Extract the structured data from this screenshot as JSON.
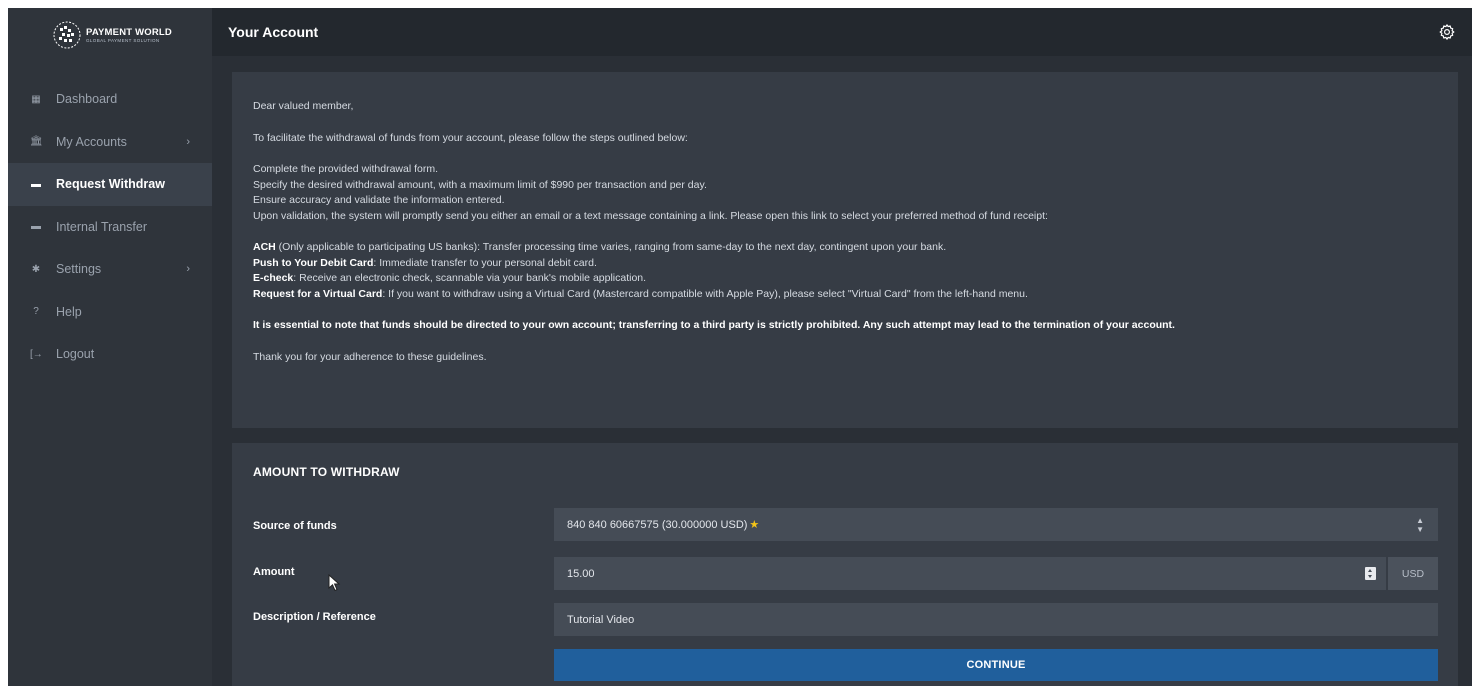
{
  "brand": {
    "name": "PAYMENT WORLD",
    "tagline": "GLOBAL PAYMENT SOLUTION"
  },
  "sidebar": {
    "items": [
      {
        "label": "Dashboard",
        "icon": "dashboard-icon",
        "active": false,
        "has_submenu": false
      },
      {
        "label": "My Accounts",
        "icon": "bank-icon",
        "active": false,
        "has_submenu": true
      },
      {
        "label": "Request Withdraw",
        "icon": "withdraw-icon",
        "active": true,
        "has_submenu": false
      },
      {
        "label": "Internal Transfer",
        "icon": "transfer-icon",
        "active": false,
        "has_submenu": false
      },
      {
        "label": "Settings",
        "icon": "gear-icon",
        "active": false,
        "has_submenu": true
      },
      {
        "label": "Help",
        "icon": "help-icon",
        "active": false,
        "has_submenu": false
      },
      {
        "label": "Logout",
        "icon": "logout-icon",
        "active": false,
        "has_submenu": false
      }
    ]
  },
  "header": {
    "title": "Your Account",
    "settings_icon": "gear-icon"
  },
  "info": {
    "greeting": "Dear valued member,",
    "intro": "To facilitate the withdrawal of funds from your account, please follow the steps outlined below:",
    "steps": [
      "Complete the provided withdrawal form.",
      "Specify the desired withdrawal amount, with a maximum limit of $990 per transaction and per day.",
      "Ensure accuracy and validate the information entered.",
      "Upon validation, the system will promptly send you either an email or a text message containing a link. Please open this link to select your preferred method of fund receipt:"
    ],
    "methods": [
      {
        "name": "ACH",
        "text": " (Only applicable to participating US banks): Transfer processing time varies, ranging from same-day to the next day, contingent upon your bank."
      },
      {
        "name": "Push to Your Debit Card",
        "text": ": Immediate transfer to your personal debit card."
      },
      {
        "name": "E-check",
        "text": ": Receive an electronic check, scannable via your bank's mobile application."
      },
      {
        "name": "Request for a Virtual Card",
        "text": ": If you want to withdraw using a Virtual Card (Mastercard compatible with Apple Pay), please select \"Virtual Card\" from the left-hand menu."
      }
    ],
    "warning": "It is essential to note that funds should be directed to your own account; transferring to a third party is strictly prohibited. Any such attempt may lead to the termination of your account.",
    "closing": "Thank you for your adherence to these guidelines."
  },
  "form": {
    "title": "AMOUNT TO WITHDRAW",
    "source_label": "Source of funds",
    "source_value": "840 840 60667575 (30.000000 USD)",
    "source_star": "★",
    "amount_label": "Amount",
    "amount_value": "15.00",
    "currency": "USD",
    "description_label": "Description / Reference",
    "description_value": "Tutorial Video",
    "continue_label": "CONTINUE"
  },
  "colors": {
    "sidebar_bg": "#2f343b",
    "header_bg": "#23282e",
    "panel_bg": "#363c45",
    "active_item_bg": "#3a414b",
    "button": "#205f9c",
    "star": "#f5c518"
  }
}
